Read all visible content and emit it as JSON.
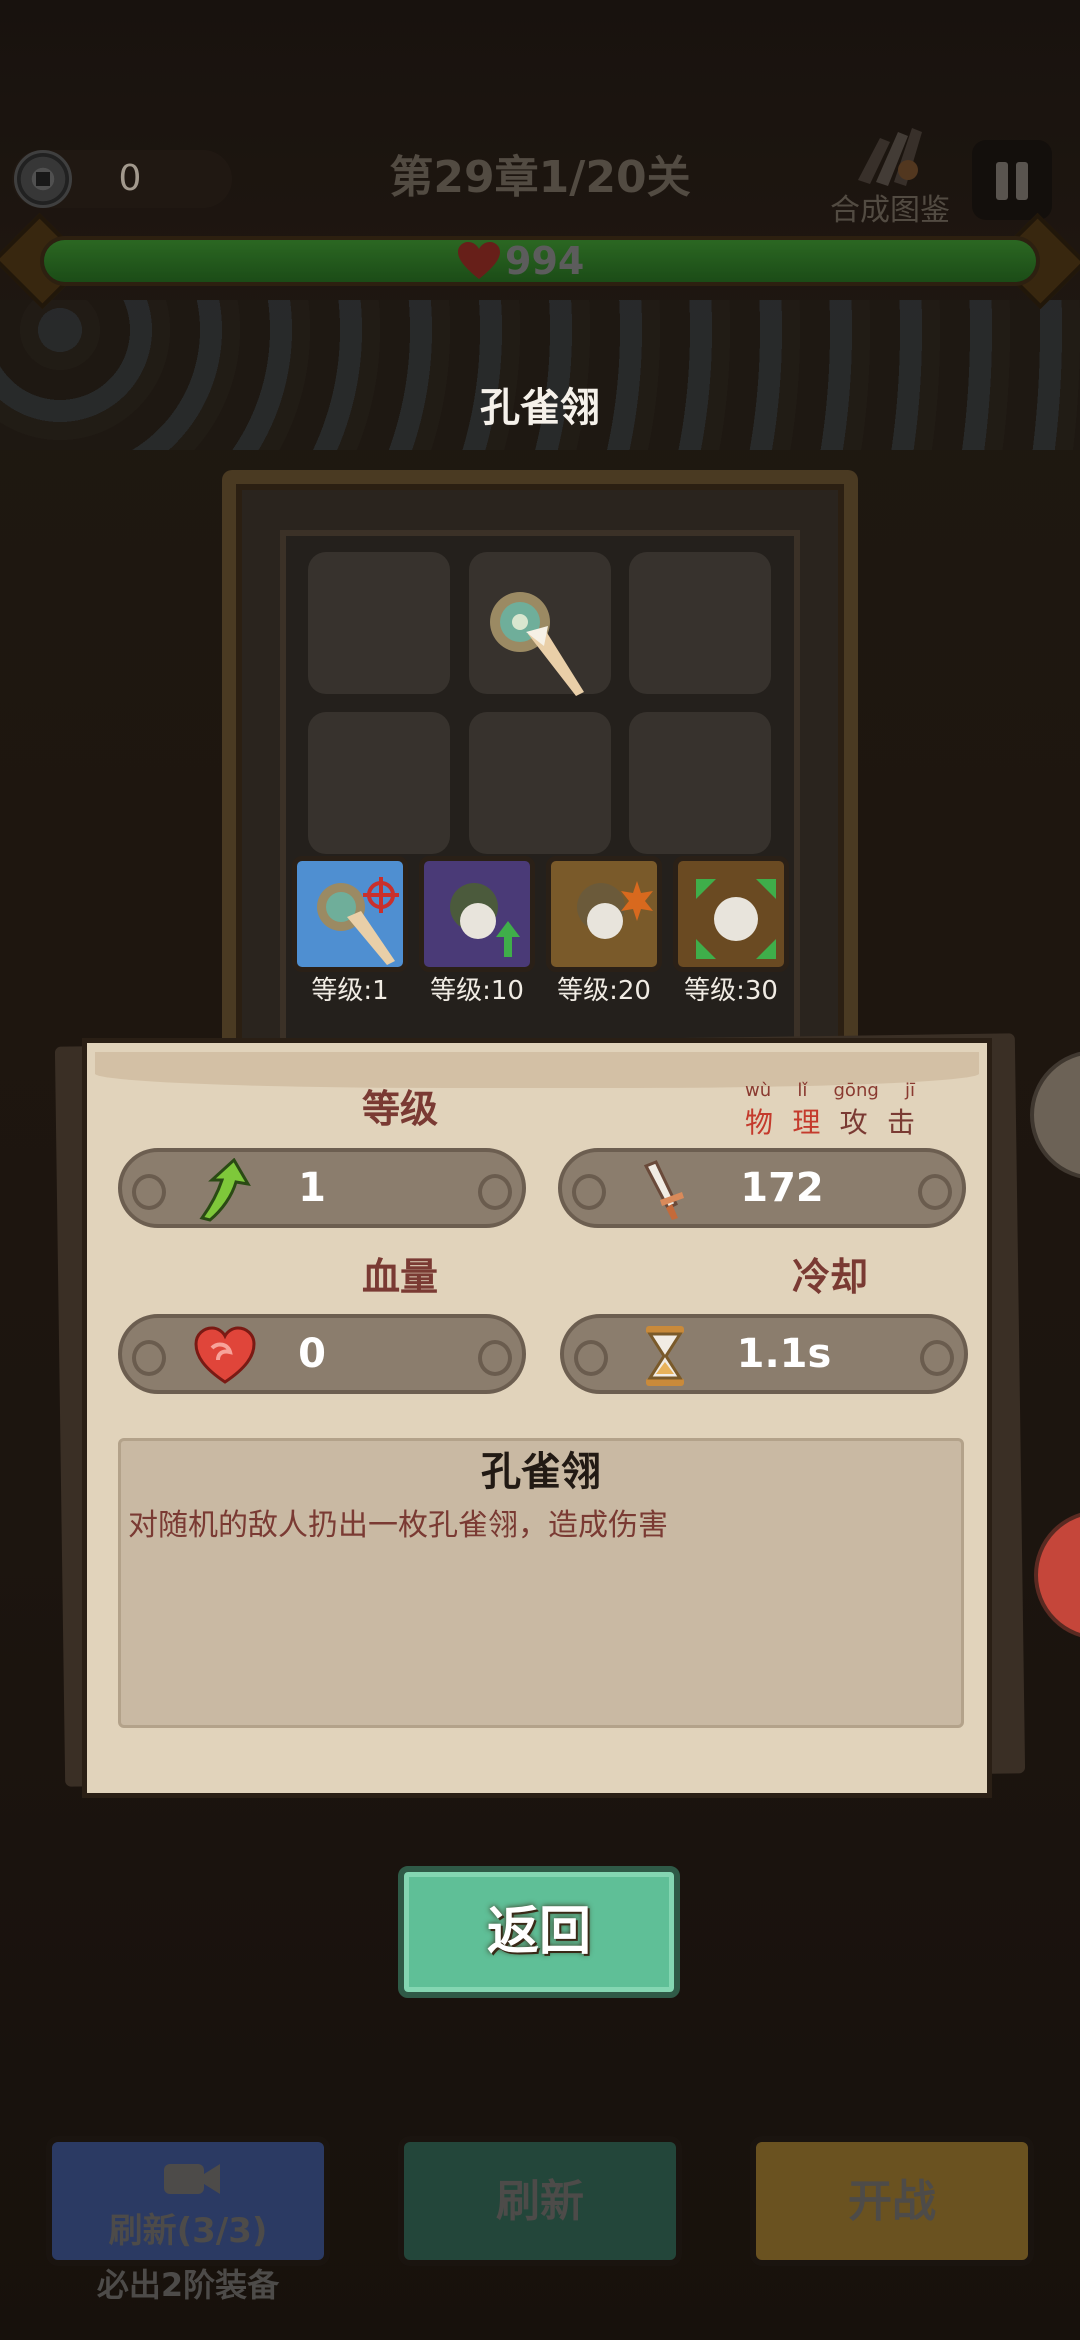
{
  "topbar": {
    "coins": "0",
    "level_title": "第29章1/20关",
    "codex_label": "合成图鉴",
    "hp_value": "994"
  },
  "item": {
    "name": "孔雀翎",
    "tiers": [
      {
        "label": "等级:1"
      },
      {
        "label": "等级:10"
      },
      {
        "label": "等级:20"
      },
      {
        "label": "等级:30"
      }
    ]
  },
  "stats": {
    "level_head": "等级",
    "level_value": "1",
    "attack_pinyin": [
      "wù",
      "lǐ",
      "gōng",
      "jī"
    ],
    "attack_hanzi": [
      "物",
      "理",
      "攻",
      "击"
    ],
    "attack_value": "172",
    "hp_head": "血量",
    "hp_value": "0",
    "cooldown_head": "冷却",
    "cooldown_value": "1.1s"
  },
  "description": {
    "title": "孔雀翎",
    "text": "对随机的敌人扔出一枚孔雀翎，造成伤害"
  },
  "buttons": {
    "back": "返回",
    "refresh_ad": "刷新(3/3)",
    "refresh_ad_note": "必出2阶装备",
    "refresh": "刷新",
    "start": "开战"
  },
  "colors": {
    "hp_fill": "#3a8a2e",
    "back_button": "#5fbf97",
    "refresh_ad_button": "#2b3a63",
    "refresh_button": "#23463a",
    "start_button": "#6a5220"
  },
  "progress": {
    "hp_fraction": 1.0
  }
}
